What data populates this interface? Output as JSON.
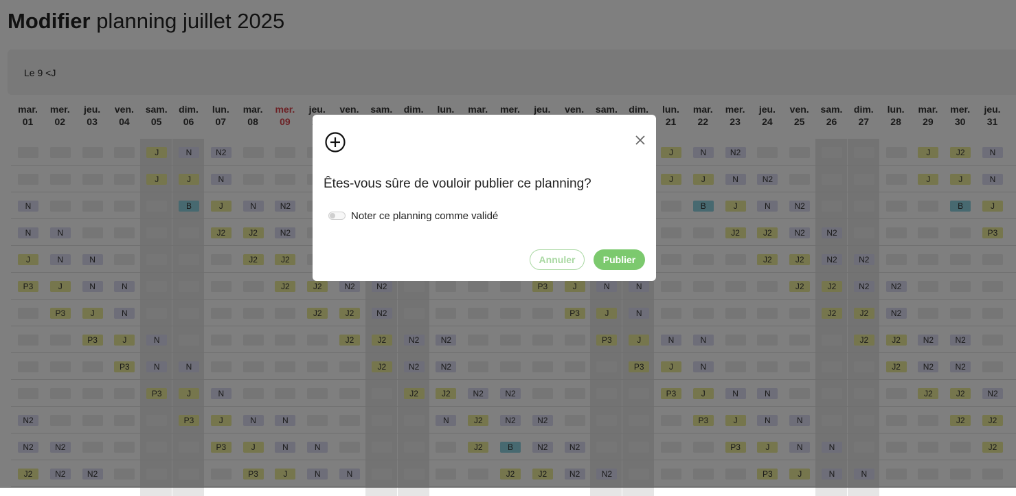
{
  "header": {
    "title_bold": "Modifier",
    "title_rest": "planning juillet 2025"
  },
  "info": {
    "text": "Le 9 <J"
  },
  "calendar": {
    "days": [
      {
        "dow": "mar.",
        "num": "01"
      },
      {
        "dow": "mer.",
        "num": "02"
      },
      {
        "dow": "jeu.",
        "num": "03"
      },
      {
        "dow": "ven.",
        "num": "04"
      },
      {
        "dow": "sam.",
        "num": "05",
        "weekend": true
      },
      {
        "dow": "dim.",
        "num": "06",
        "weekend": true
      },
      {
        "dow": "lun.",
        "num": "07"
      },
      {
        "dow": "mar.",
        "num": "08"
      },
      {
        "dow": "mer.",
        "num": "09",
        "today": true
      },
      {
        "dow": "jeu.",
        "num": "10"
      },
      {
        "dow": "ven.",
        "num": "11"
      },
      {
        "dow": "sam.",
        "num": "12",
        "weekend": true
      },
      {
        "dow": "dim.",
        "num": "13",
        "weekend": true
      },
      {
        "dow": "lun.",
        "num": "14"
      },
      {
        "dow": "mar.",
        "num": "15"
      },
      {
        "dow": "mer.",
        "num": "16"
      },
      {
        "dow": "jeu.",
        "num": "17"
      },
      {
        "dow": "ven.",
        "num": "18"
      },
      {
        "dow": "sam.",
        "num": "19",
        "weekend": true
      },
      {
        "dow": "dim.",
        "num": "20",
        "weekend": true
      },
      {
        "dow": "lun.",
        "num": "21"
      },
      {
        "dow": "mar.",
        "num": "22"
      },
      {
        "dow": "mer.",
        "num": "23"
      },
      {
        "dow": "jeu.",
        "num": "24"
      },
      {
        "dow": "ven.",
        "num": "25"
      },
      {
        "dow": "sam.",
        "num": "26",
        "weekend": true
      },
      {
        "dow": "dim.",
        "num": "27",
        "weekend": true
      },
      {
        "dow": "lun.",
        "num": "28"
      },
      {
        "dow": "mar.",
        "num": "29"
      },
      {
        "dow": "mer.",
        "num": "30"
      },
      {
        "dow": "jeu.",
        "num": "31"
      }
    ],
    "rows": [
      [
        "",
        "",
        "",
        "",
        "J",
        "N",
        "N2",
        "",
        "",
        "",
        "",
        "",
        "",
        "",
        "",
        "",
        "",
        "",
        "",
        "",
        "J",
        "N",
        "N2",
        "",
        "",
        "",
        "",
        "",
        "J",
        "J2",
        "N"
      ],
      [
        "",
        "",
        "",
        "",
        "J",
        "J",
        "N",
        "",
        "",
        "",
        "",
        "",
        "",
        "",
        "",
        "",
        "",
        "",
        "",
        "",
        "J",
        "J",
        "N",
        "N2",
        "",
        "",
        "",
        "",
        "J",
        "J",
        "N"
      ],
      [
        "N",
        "",
        "",
        "",
        "",
        "B",
        "J",
        "N",
        "N2",
        "",
        "",
        "",
        "",
        "",
        "",
        "",
        "",
        "",
        "",
        "",
        "",
        "B",
        "J",
        "N",
        "N2",
        "",
        "",
        "",
        "",
        "B",
        "J"
      ],
      [
        "N",
        "N",
        "",
        "",
        "",
        "",
        "J2",
        "J2",
        "N2",
        "",
        "",
        "",
        "",
        "",
        "",
        "",
        "",
        "",
        "",
        "",
        "",
        "",
        "J2",
        "J2",
        "N2",
        "N2",
        "",
        "",
        "",
        "",
        "P3"
      ],
      [
        "J",
        "N",
        "N",
        "",
        "",
        "",
        "",
        "J2",
        "J2",
        "",
        "",
        "",
        "",
        "",
        "",
        "",
        "",
        "",
        "",
        "",
        "",
        "",
        "",
        "J2",
        "J2",
        "N2",
        "N2",
        "",
        "",
        "",
        ""
      ],
      [
        "P3",
        "J",
        "N",
        "N",
        "",
        "",
        "",
        "",
        "J2",
        "J2",
        "N2",
        "N2",
        "",
        "",
        "",
        "",
        "P3",
        "J",
        "N",
        "N",
        "",
        "",
        "",
        "",
        "J2",
        "J2",
        "N2",
        "N2",
        "",
        "",
        ""
      ],
      [
        "",
        "P3",
        "J",
        "N",
        "",
        "",
        "",
        "",
        "",
        "J2",
        "J2",
        "N2",
        "",
        "",
        "",
        "",
        "",
        "P3",
        "J",
        "N",
        "",
        "",
        "",
        "",
        "",
        "J2",
        "J2",
        "N2",
        "",
        "",
        ""
      ],
      [
        "",
        "",
        "P3",
        "J",
        "N",
        "",
        "",
        "",
        "",
        "",
        "J2",
        "J2",
        "N2",
        "N2",
        "",
        "",
        "",
        "",
        "P3",
        "J",
        "N",
        "N",
        "",
        "",
        "",
        "",
        "J2",
        "J2",
        "N2",
        "N2",
        ""
      ],
      [
        "",
        "",
        "",
        "P3",
        "N",
        "N",
        "",
        "",
        "",
        "",
        "",
        "J2",
        "N2",
        "N2",
        "",
        "",
        "",
        "",
        "",
        "P3",
        "J",
        "N",
        "",
        "",
        "",
        "",
        "",
        "J2",
        "N2",
        "N2",
        ""
      ],
      [
        "",
        "",
        "",
        "",
        "P3",
        "J",
        "N",
        "",
        "",
        "",
        "",
        "",
        "J2",
        "J2",
        "N2",
        "N2",
        "",
        "",
        "",
        "",
        "P3",
        "J",
        "N",
        "N",
        "",
        "",
        "",
        "",
        "J2",
        "J2",
        "N2"
      ],
      [
        "N2",
        "",
        "",
        "",
        "",
        "P3",
        "J",
        "N",
        "N",
        "",
        "",
        "",
        "",
        "N",
        "J2",
        "N2",
        "N2",
        "",
        "",
        "",
        "",
        "P3",
        "J",
        "N",
        "N",
        "",
        "",
        "",
        "",
        "J2",
        "J2"
      ],
      [
        "N2",
        "N2",
        "",
        "",
        "",
        "",
        "P3",
        "J",
        "N",
        "N",
        "",
        "",
        "",
        "",
        "J2",
        "B",
        "N2",
        "N2",
        "",
        "",
        "",
        "",
        "P3",
        "J",
        "N",
        "N",
        "",
        "",
        "",
        "",
        "J2"
      ],
      [
        "J2",
        "N2",
        "N2",
        "",
        "",
        "",
        "",
        "P3",
        "J",
        "N",
        "N",
        "",
        "",
        "",
        "",
        "J2",
        "J2",
        "N2",
        "N2",
        "",
        "",
        "",
        "",
        "P3",
        "J",
        "N",
        "N",
        "",
        "",
        "",
        ""
      ]
    ]
  },
  "modal": {
    "icon": "plus-circle-icon",
    "close_icon": "close-icon",
    "question": "Êtes-vous sûre de vouloir publier ce planning?",
    "toggle_label": "Noter ce planning comme validé",
    "toggle_on": false,
    "cancel_label": "Annuler",
    "publish_label": "Publier"
  }
}
